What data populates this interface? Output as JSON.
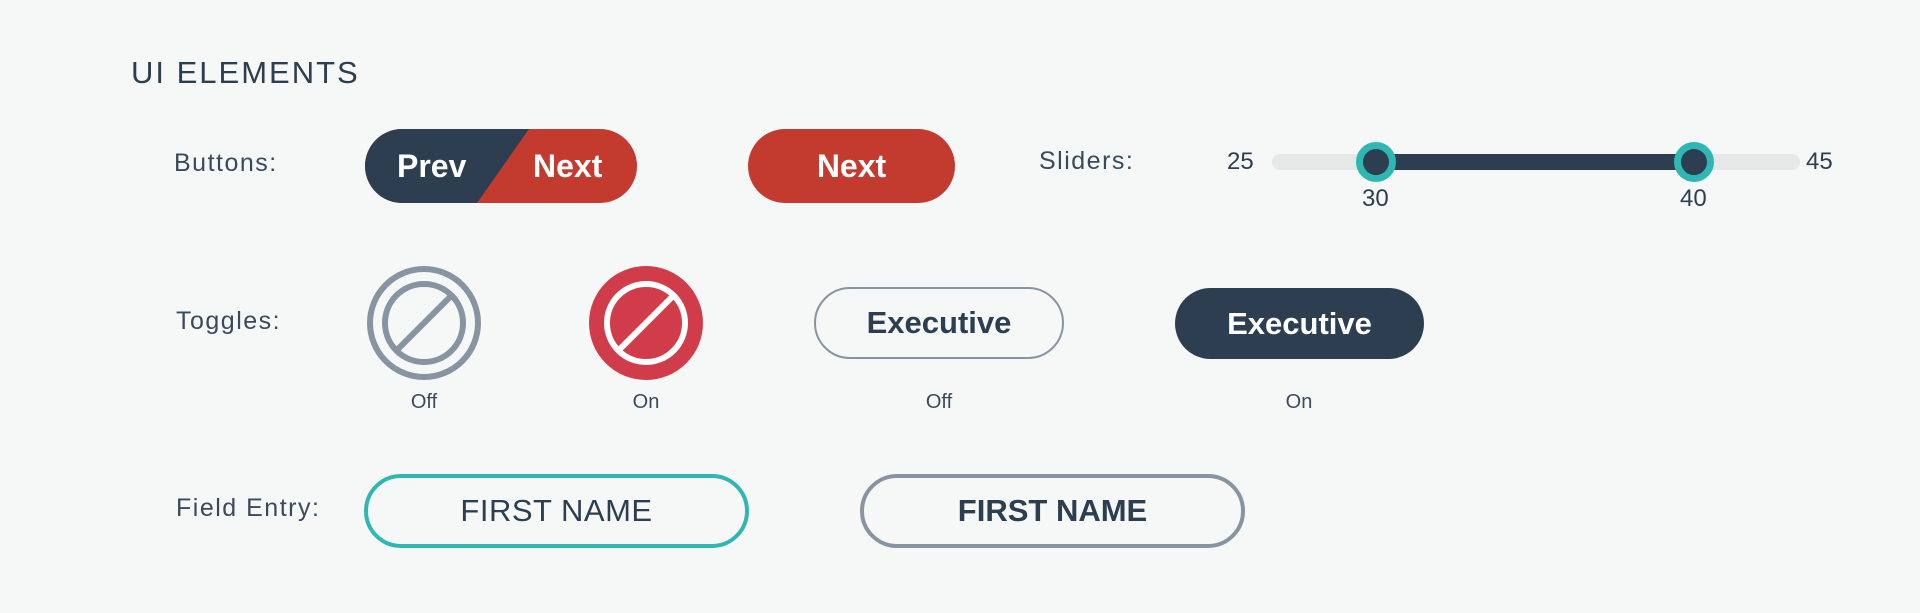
{
  "title": "UI ELEMENTS",
  "colors": {
    "navy": "#2d3e50",
    "red": "#c33a2e",
    "toggle_red": "#d13c4a",
    "teal": "#2fb8b3",
    "gray": "#8795a3",
    "track": "#e6e7e7",
    "background": "#f6f8f7"
  },
  "buttons": {
    "label": "Buttons:",
    "split_prev": "Prev",
    "split_next": "Next",
    "next": "Next"
  },
  "sliders": {
    "label": "Sliders:",
    "min": "25",
    "max": "45",
    "low": "30",
    "high": "40"
  },
  "toggles": {
    "label": "Toggles:",
    "icon_off_state": "Off",
    "icon_on_state": "On",
    "exec_off_label": "Executive",
    "exec_off_state": "Off",
    "exec_on_label": "Executive",
    "exec_on_state": "On",
    "icon_name": "prohibited-icon"
  },
  "fields": {
    "label": "Field Entry:",
    "active_placeholder": "FIRST NAME",
    "default_placeholder": "FIRST NAME"
  }
}
